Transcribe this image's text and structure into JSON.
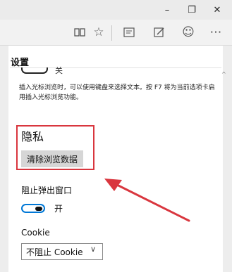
{
  "window": {
    "minimize_icon": "minimize-icon",
    "restore_icon": "restore-icon",
    "close_icon": "close-icon"
  },
  "toolbar": {
    "icons": [
      "reading-view-icon",
      "favorites-star-icon",
      "hub-icon",
      "web-note-icon",
      "feedback-smiley-icon",
      "more-icon"
    ]
  },
  "settings": {
    "title": "设置",
    "caret_browsing_toggle_label": "关",
    "caret_browsing_description": "插入光标浏览时，可以使用键盘来选择文本。按 F7 将为当前选项卡启用插入光标浏览功能。",
    "privacy_heading": "隐私",
    "clear_button_label": "清除浏览数据",
    "block_popups_label": "阻止弹出窗口",
    "block_popups_state": "开",
    "cookie_label": "Cookie",
    "cookie_value": "不阻止 Cookie",
    "chevron_icon": "chevron-down-icon",
    "scroll_icon": "scroll-up-icon"
  },
  "annotation": {
    "highlight_color": "#d9363e",
    "arrow_color": "#d9363e"
  },
  "colors": {
    "toggle_accent": "#0078d7",
    "button_bg": "#d6d6d6"
  }
}
